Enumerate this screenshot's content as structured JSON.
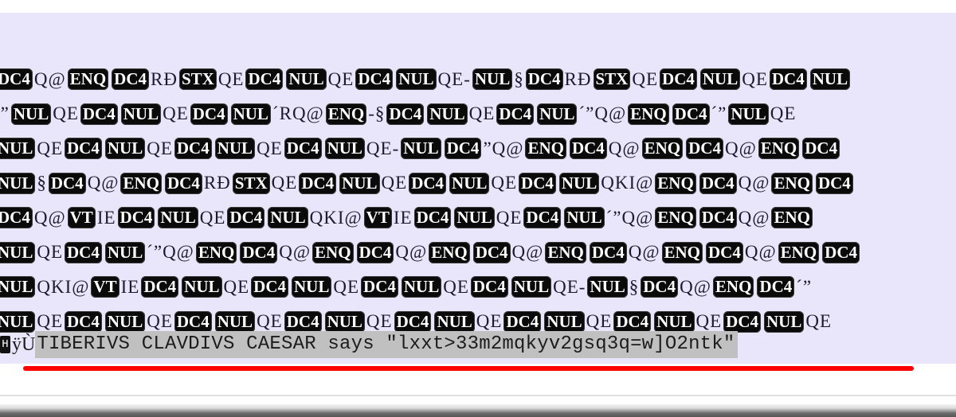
{
  "editor": {
    "background": "#e9e6fb",
    "badge_color": "#0a0a0a",
    "highlight_color": "#c0c0c0",
    "underline_color": "#ff0000",
    "rows": [
      [
        {
          "c": "DC4"
        },
        "Q@",
        {
          "c": "ENQ"
        },
        {
          "c": "DC4"
        },
        "RĐ",
        {
          "c": "STX"
        },
        "QE",
        {
          "c": "DC4"
        },
        {
          "c": "NUL"
        },
        "QE",
        {
          "c": "DC4"
        },
        {
          "c": "NUL"
        },
        "QE-",
        {
          "c": "NUL"
        },
        "§",
        {
          "c": "DC4"
        },
        "RĐ",
        {
          "c": "STX"
        },
        "QE",
        {
          "c": "DC4"
        },
        {
          "c": "NUL"
        },
        "QE",
        {
          "c": "DC4"
        },
        {
          "c": "NUL"
        }
      ],
      [
        "´”",
        {
          "c": "NUL"
        },
        "QE",
        {
          "c": "DC4"
        },
        {
          "c": "NUL"
        },
        "QE",
        {
          "c": "DC4"
        },
        {
          "c": "NUL"
        },
        "´RQ@",
        {
          "c": "ENQ"
        },
        "-§",
        {
          "c": "DC4"
        },
        {
          "c": "NUL"
        },
        "QE",
        {
          "c": "DC4"
        },
        {
          "c": "NUL"
        },
        "´”Q@",
        {
          "c": "ENQ"
        },
        {
          "c": "DC4"
        },
        "´”",
        {
          "c": "NUL"
        },
        "QE"
      ],
      [
        {
          "c": "NUL"
        },
        "QE",
        {
          "c": "DC4"
        },
        {
          "c": "NUL"
        },
        "QE",
        {
          "c": "DC4"
        },
        {
          "c": "NUL"
        },
        "QE",
        {
          "c": "DC4"
        },
        {
          "c": "NUL"
        },
        "QE-",
        {
          "c": "NUL"
        },
        {
          "c": "DC4"
        },
        "”Q@",
        {
          "c": "ENQ"
        },
        {
          "c": "DC4"
        },
        "Q@",
        {
          "c": "ENQ"
        },
        {
          "c": "DC4"
        },
        "Q@",
        {
          "c": "ENQ"
        },
        {
          "c": "DC4"
        }
      ],
      [
        {
          "c": "NUL"
        },
        "§",
        {
          "c": "DC4"
        },
        "Q@",
        {
          "c": "ENQ"
        },
        {
          "c": "DC4"
        },
        "RĐ",
        {
          "c": "STX"
        },
        "QE",
        {
          "c": "DC4"
        },
        {
          "c": "NUL"
        },
        "QE",
        {
          "c": "DC4"
        },
        {
          "c": "NUL"
        },
        "QE",
        {
          "c": "DC4"
        },
        {
          "c": "NUL"
        },
        "QKI@",
        {
          "c": "ENQ"
        },
        {
          "c": "DC4"
        },
        "Q@",
        {
          "c": "ENQ"
        },
        {
          "c": "DC4"
        }
      ],
      [
        {
          "c": "DC4"
        },
        "Q@",
        {
          "c": "VT"
        },
        "IE",
        {
          "c": "DC4"
        },
        {
          "c": "NUL"
        },
        "QE",
        {
          "c": "DC4"
        },
        {
          "c": "NUL"
        },
        "QKI@",
        {
          "c": "VT"
        },
        "IE",
        {
          "c": "DC4"
        },
        {
          "c": "NUL"
        },
        "QE",
        {
          "c": "DC4"
        },
        {
          "c": "NUL"
        },
        "´”Q@",
        {
          "c": "ENQ"
        },
        {
          "c": "DC4"
        },
        "Q@",
        {
          "c": "ENQ"
        }
      ],
      [
        {
          "c": "NUL"
        },
        "QE",
        {
          "c": "DC4"
        },
        {
          "c": "NUL"
        },
        "´”Q@",
        {
          "c": "ENQ"
        },
        {
          "c": "DC4"
        },
        "Q@",
        {
          "c": "ENQ"
        },
        {
          "c": "DC4"
        },
        "Q@",
        {
          "c": "ENQ"
        },
        {
          "c": "DC4"
        },
        "Q@",
        {
          "c": "ENQ"
        },
        {
          "c": "DC4"
        },
        "Q@",
        {
          "c": "ENQ"
        },
        {
          "c": "DC4"
        },
        "Q@",
        {
          "c": "ENQ"
        },
        {
          "c": "DC4"
        }
      ],
      [
        {
          "c": "NUL"
        },
        "QKI@",
        {
          "c": "VT"
        },
        "IE",
        {
          "c": "DC4"
        },
        {
          "c": "NUL"
        },
        "QE",
        {
          "c": "DC4"
        },
        {
          "c": "NUL"
        },
        "QE",
        {
          "c": "DC4"
        },
        {
          "c": "NUL"
        },
        "QE",
        {
          "c": "DC4"
        },
        {
          "c": "NUL"
        },
        "QE-",
        {
          "c": "NUL"
        },
        "§",
        {
          "c": "DC4"
        },
        "Q@",
        {
          "c": "ENQ"
        },
        {
          "c": "DC4"
        },
        "´”"
      ],
      [
        {
          "c": "NUL"
        },
        "QE",
        {
          "c": "DC4"
        },
        {
          "c": "NUL"
        },
        "QE",
        {
          "c": "DC4"
        },
        {
          "c": "NUL"
        },
        "QE",
        {
          "c": "DC4"
        },
        {
          "c": "NUL"
        },
        "QE",
        {
          "c": "DC4"
        },
        {
          "c": "NUL"
        },
        "QE",
        {
          "c": "DC4"
        },
        {
          "c": "NUL"
        },
        "QE",
        {
          "c": "DC4"
        },
        {
          "c": "NUL"
        },
        "QE",
        {
          "c": "DC4"
        },
        {
          "c": "NUL"
        },
        "QE"
      ]
    ],
    "last_line": {
      "prefix_badge": "H",
      "prefix_text": "ÿÙ",
      "selected_text": "TIBERIVS CLAVDIVS CAESAR says \"lxxt>33m2mqkyv2gsq3q=w]O2ntk\""
    }
  }
}
